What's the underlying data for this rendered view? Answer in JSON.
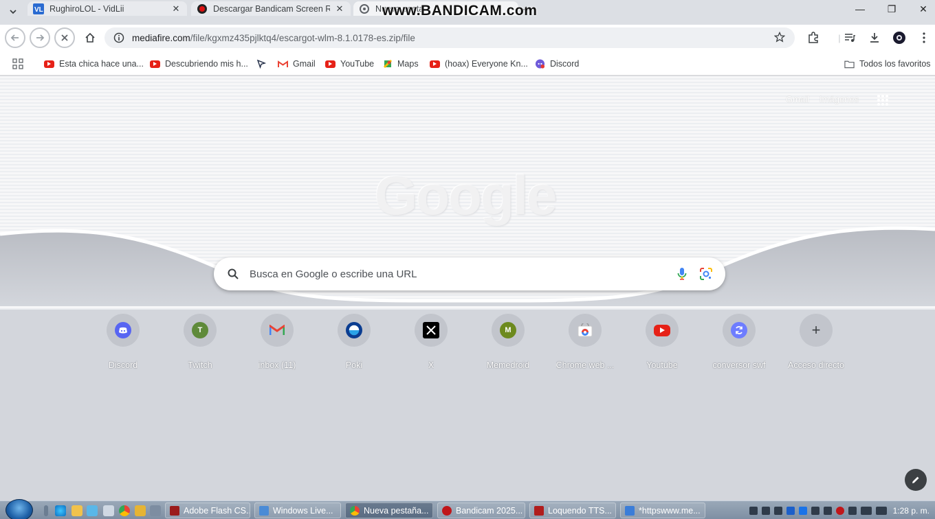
{
  "watermark": "www.BANDICAM.com",
  "tabs": [
    {
      "title": "RughiroLOL - VidLii",
      "close": "✕"
    },
    {
      "title": "Descargar Bandicam Screen Re",
      "close": "✕"
    },
    {
      "title": "Nueva pesta",
      "close": ""
    }
  ],
  "newtab_symbol": "+",
  "window_controls": {
    "minimize": "—",
    "maximize": "❐",
    "close": "✕"
  },
  "toolbar": {
    "url_host": "mediafire.com",
    "url_path": "/file/kgxmz435pjlktq4/escargot-wlm-8.1.0178-es.zip/file"
  },
  "bookmarks": [
    {
      "label": "Esta chica hace una...",
      "icon": "youtube-icon"
    },
    {
      "label": "Descubriendo mis h...",
      "icon": "youtube-icon"
    },
    {
      "label": "",
      "icon": "cursor-icon"
    },
    {
      "label": "Gmail",
      "icon": "gmail-icon"
    },
    {
      "label": "YouTube",
      "icon": "youtube-icon"
    },
    {
      "label": "Maps",
      "icon": "maps-icon"
    },
    {
      "label": "(hoax) Everyone Kn...",
      "icon": "youtube-icon"
    },
    {
      "label": "Discord",
      "icon": "discord-icon"
    }
  ],
  "all_bookmarks": "Todos los favoritos",
  "ntp": {
    "gmail_link": "Gmail",
    "images_link": "Imágenes",
    "logo_text": "Google",
    "search_placeholder": "Busca en Google o escribe una URL",
    "shortcuts": [
      {
        "label": "Discord",
        "icon": "discord-icon",
        "color": "#5865f2"
      },
      {
        "label": "Twitch",
        "icon": "letter-t-icon",
        "color": "#5f8a3a",
        "letter": "T"
      },
      {
        "label": "inbox (11)",
        "icon": "gmail-icon",
        "color": "#ffffff"
      },
      {
        "label": "Poki",
        "icon": "poki-icon",
        "color": "#0b3d91"
      },
      {
        "label": "X",
        "icon": "x-icon",
        "color": "#000000"
      },
      {
        "label": "Memedroid",
        "icon": "letter-m-icon",
        "color": "#6d8a1e",
        "letter": "M"
      },
      {
        "label": "Chrome web ...",
        "icon": "chrome-web-store-icon",
        "color": "#ffffff"
      },
      {
        "label": "Youtube",
        "icon": "youtube-icon",
        "color": "#e62117"
      },
      {
        "label": "conversor swf",
        "icon": "convert-icon",
        "color": "#6e7dff"
      },
      {
        "label": "Acceso directo",
        "icon": "add-icon",
        "color": "#c2c5cc",
        "letter": "+"
      }
    ]
  },
  "taskbar": {
    "items": [
      {
        "label": "Adobe Flash CS...",
        "color": "#9b1c1c"
      },
      {
        "label": "Windows Live...",
        "color": "#4a8bd6"
      },
      {
        "label": "Nueva pestaña...",
        "color": "#4285f4"
      },
      {
        "label": "Bandicam 2025...",
        "color": "#c0161a"
      },
      {
        "label": "Loquendo TTS...",
        "color": "#b01d1d"
      },
      {
        "label": "*httpswww.me...",
        "color": "#3b7dd8"
      }
    ],
    "clock": "1:28 p. m."
  }
}
